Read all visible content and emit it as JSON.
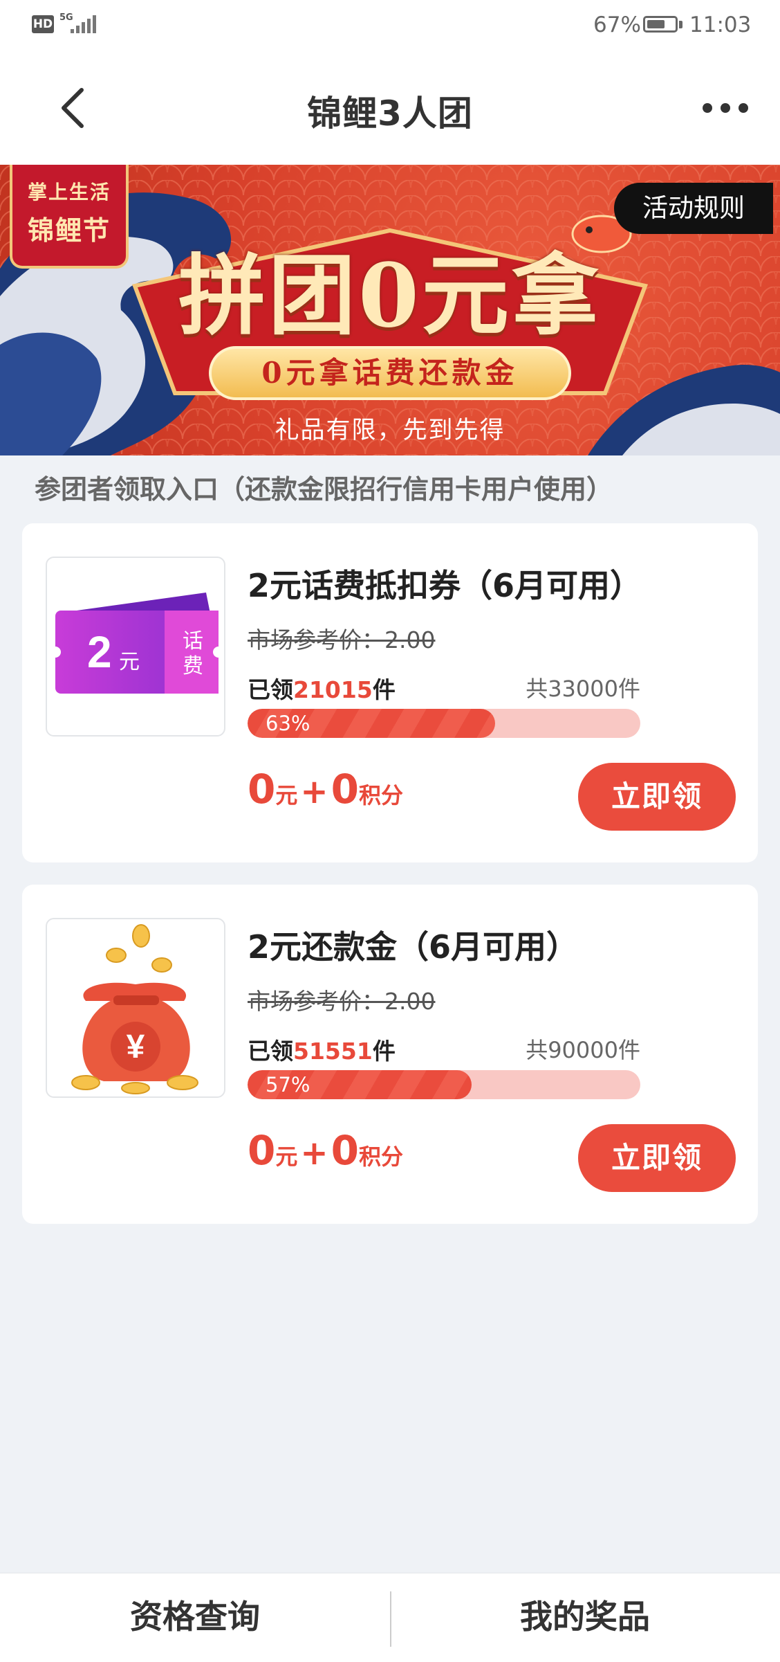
{
  "status_bar": {
    "network_label": "HD",
    "signal_label": "5G",
    "battery": "67%",
    "battery_level": 0.67,
    "time": "11:03"
  },
  "nav": {
    "title": "锦鲤3人团",
    "back_icon": "chevron-left-icon",
    "more_icon": "more-dots-icon"
  },
  "banner": {
    "tag_line1": "掌上生活",
    "tag_line2": "锦鲤节",
    "rules_button": "活动规则",
    "headline": "拼团0元拿",
    "pill_text": "0元拿话费还款金",
    "subline": "礼品有限，先到先得"
  },
  "section_title": "参团者领取入口（还款金限招行信用卡用户使用）",
  "products": [
    {
      "name": "2元话费抵扣券（6月可用）",
      "market_price": "市场参考价：2.00",
      "claimed_prefix": "已领",
      "claimed_count": "21015",
      "claimed_suffix": "件",
      "total": "共33000件",
      "progress_label": "63%",
      "progress": 0.63,
      "price_yuan": "0",
      "price_yuan_unit": "元",
      "price_plus": "+",
      "price_points": "0",
      "price_points_unit": "积分",
      "button": "立即领",
      "image": {
        "icon": "phone-bill-coupon-icon",
        "amount": "2",
        "unit": "元",
        "tag": "话费"
      }
    },
    {
      "name": "2元还款金（6月可用）",
      "market_price": "市场参考价：2.00",
      "claimed_prefix": "已领",
      "claimed_count": "51551",
      "claimed_suffix": "件",
      "total": "共90000件",
      "progress_label": "57%",
      "progress": 0.57,
      "price_yuan": "0",
      "price_yuan_unit": "元",
      "price_plus": "+",
      "price_points": "0",
      "price_points_unit": "积分",
      "button": "立即领",
      "image": {
        "icon": "money-bag-icon",
        "symbol": "¥"
      }
    }
  ],
  "bottom_tabs": {
    "left": "资格查询",
    "right": "我的奖品"
  },
  "colors": {
    "accent": "#ea4c3d",
    "background": "#eff2f6",
    "banner_red": "#d8412b"
  }
}
